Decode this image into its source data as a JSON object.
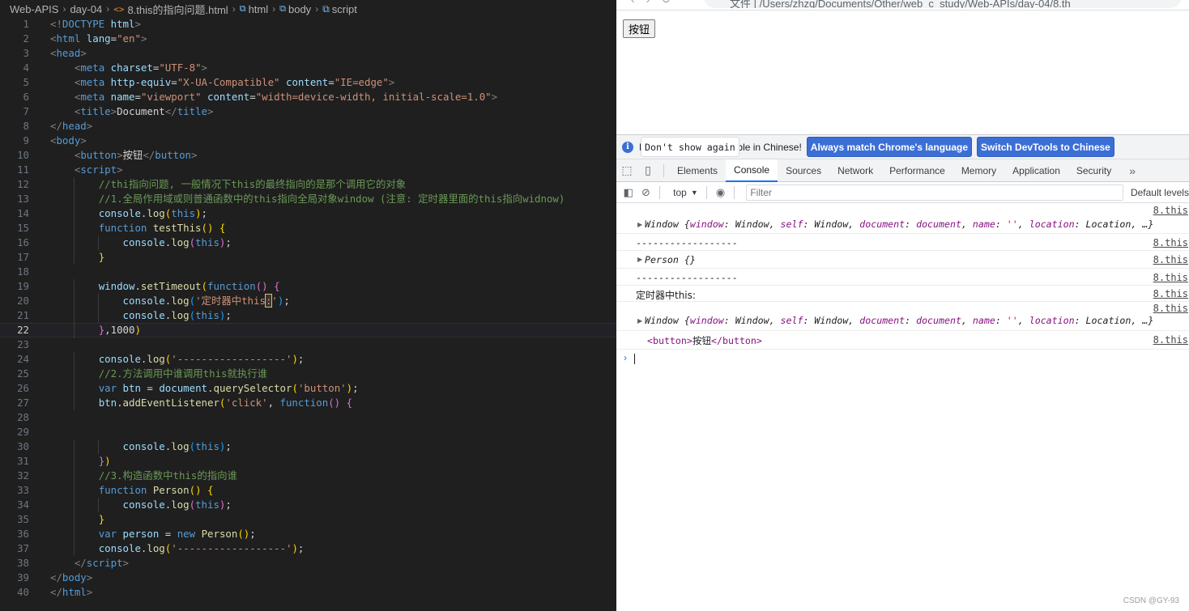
{
  "editor": {
    "breadcrumb": {
      "folder1": "Web-APIS",
      "folder2": "day-04",
      "file": "8.this的指向问题.html",
      "node1": "html",
      "node2": "body",
      "node3": "script"
    },
    "current_line": 22,
    "lines": [
      {
        "n": 1,
        "t": [
          [
            "t-punc",
            "<!"
          ],
          [
            "t-tag",
            "DOCTYPE"
          ],
          [
            "t-txt",
            " "
          ],
          [
            "t-attr",
            "html"
          ],
          [
            "t-punc",
            ">"
          ]
        ]
      },
      {
        "n": 2,
        "t": [
          [
            "t-punc",
            "<"
          ],
          [
            "t-tag",
            "html"
          ],
          [
            "t-txt",
            " "
          ],
          [
            "t-attr",
            "lang"
          ],
          [
            "t-txt",
            "="
          ],
          [
            "t-str",
            "\"en\""
          ],
          [
            "t-punc",
            ">"
          ]
        ]
      },
      {
        "n": 3,
        "t": [
          [
            "t-punc",
            "<"
          ],
          [
            "t-tag",
            "head"
          ],
          [
            "t-punc",
            ">"
          ]
        ]
      },
      {
        "n": 4,
        "t": [
          [
            "t-txt",
            "    "
          ],
          [
            "t-punc",
            "<"
          ],
          [
            "t-tag",
            "meta"
          ],
          [
            "t-txt",
            " "
          ],
          [
            "t-attr",
            "charset"
          ],
          [
            "t-txt",
            "="
          ],
          [
            "t-str",
            "\"UTF-8\""
          ],
          [
            "t-punc",
            ">"
          ]
        ]
      },
      {
        "n": 5,
        "t": [
          [
            "t-txt",
            "    "
          ],
          [
            "t-punc",
            "<"
          ],
          [
            "t-tag",
            "meta"
          ],
          [
            "t-txt",
            " "
          ],
          [
            "t-attr",
            "http-equiv"
          ],
          [
            "t-txt",
            "="
          ],
          [
            "t-str",
            "\"X-UA-Compatible\""
          ],
          [
            "t-txt",
            " "
          ],
          [
            "t-attr",
            "content"
          ],
          [
            "t-txt",
            "="
          ],
          [
            "t-str",
            "\"IE=edge\""
          ],
          [
            "t-punc",
            ">"
          ]
        ]
      },
      {
        "n": 6,
        "t": [
          [
            "t-txt",
            "    "
          ],
          [
            "t-punc",
            "<"
          ],
          [
            "t-tag",
            "meta"
          ],
          [
            "t-txt",
            " "
          ],
          [
            "t-attr",
            "name"
          ],
          [
            "t-txt",
            "="
          ],
          [
            "t-str",
            "\"viewport\""
          ],
          [
            "t-txt",
            " "
          ],
          [
            "t-attr",
            "content"
          ],
          [
            "t-txt",
            "="
          ],
          [
            "t-str",
            "\"width=device-width, initial-scale=1.0\""
          ],
          [
            "t-punc",
            ">"
          ]
        ]
      },
      {
        "n": 7,
        "t": [
          [
            "t-txt",
            "    "
          ],
          [
            "t-punc",
            "<"
          ],
          [
            "t-tag",
            "title"
          ],
          [
            "t-punc",
            ">"
          ],
          [
            "t-txt",
            "Document"
          ],
          [
            "t-punc",
            "</"
          ],
          [
            "t-tag",
            "title"
          ],
          [
            "t-punc",
            ">"
          ]
        ]
      },
      {
        "n": 8,
        "t": [
          [
            "t-punc",
            "</"
          ],
          [
            "t-tag",
            "head"
          ],
          [
            "t-punc",
            ">"
          ]
        ]
      },
      {
        "n": 9,
        "t": [
          [
            "t-punc",
            "<"
          ],
          [
            "t-tag",
            "body"
          ],
          [
            "t-punc",
            ">"
          ]
        ]
      },
      {
        "n": 10,
        "t": [
          [
            "t-txt",
            "    "
          ],
          [
            "t-punc",
            "<"
          ],
          [
            "t-tag",
            "button"
          ],
          [
            "t-punc",
            ">"
          ],
          [
            "t-txt",
            "按钮"
          ],
          [
            "t-punc",
            "</"
          ],
          [
            "t-tag",
            "button"
          ],
          [
            "t-punc",
            ">"
          ]
        ]
      },
      {
        "n": 11,
        "t": [
          [
            "t-txt",
            "    "
          ],
          [
            "t-punc",
            "<"
          ],
          [
            "t-tag",
            "script"
          ],
          [
            "t-punc",
            ">"
          ]
        ]
      },
      {
        "n": 12,
        "t": [
          [
            "t-txt",
            "        "
          ],
          [
            "t-cmt",
            "//thi指向问题, 一般情况下this的最终指向的是那个调用它的对象"
          ]
        ]
      },
      {
        "n": 13,
        "t": [
          [
            "t-txt",
            "        "
          ],
          [
            "t-cmt",
            "//1.全局作用域或则普通函数中的this指向全局对象window (注意: 定时器里面的this指向widnow)"
          ]
        ]
      },
      {
        "n": 14,
        "t": [
          [
            "t-txt",
            "        "
          ],
          [
            "t-var",
            "console"
          ],
          [
            "t-txt",
            "."
          ],
          [
            "t-fn",
            "log"
          ],
          [
            "t-br1",
            "("
          ],
          [
            "t-kw",
            "this"
          ],
          [
            "t-br1",
            ")"
          ],
          [
            "t-txt",
            ";"
          ]
        ]
      },
      {
        "n": 15,
        "t": [
          [
            "t-txt",
            "        "
          ],
          [
            "t-kw",
            "function"
          ],
          [
            "t-txt",
            " "
          ],
          [
            "t-fn",
            "testThis"
          ],
          [
            "t-br1",
            "()"
          ],
          [
            "t-txt",
            " "
          ],
          [
            "t-br1",
            "{"
          ]
        ]
      },
      {
        "n": 16,
        "t": [
          [
            "t-txt",
            "            "
          ],
          [
            "t-var",
            "console"
          ],
          [
            "t-txt",
            "."
          ],
          [
            "t-fn",
            "log"
          ],
          [
            "t-br2",
            "("
          ],
          [
            "t-kw",
            "this"
          ],
          [
            "t-br2",
            ")"
          ],
          [
            "t-txt",
            ";"
          ]
        ]
      },
      {
        "n": 17,
        "t": [
          [
            "t-txt",
            "        "
          ],
          [
            "t-br1",
            "}"
          ]
        ]
      },
      {
        "n": 18,
        "t": []
      },
      {
        "n": 19,
        "t": [
          [
            "t-txt",
            "        "
          ],
          [
            "t-var",
            "window"
          ],
          [
            "t-txt",
            "."
          ],
          [
            "t-fn",
            "setTimeout"
          ],
          [
            "t-br1",
            "("
          ],
          [
            "t-kw",
            "function"
          ],
          [
            "t-br2",
            "()"
          ],
          [
            "t-txt",
            " "
          ],
          [
            "t-br2",
            "{"
          ]
        ]
      },
      {
        "n": 20,
        "t": [
          [
            "t-txt",
            "            "
          ],
          [
            "t-var",
            "console"
          ],
          [
            "t-txt",
            "."
          ],
          [
            "t-fn",
            "log"
          ],
          [
            "t-br3",
            "("
          ],
          [
            "t-str",
            "'定时器中this"
          ],
          [
            "t-hl",
            ":"
          ],
          [
            "t-str",
            "'"
          ],
          [
            "t-br3",
            ")"
          ],
          [
            "t-txt",
            ";"
          ]
        ]
      },
      {
        "n": 21,
        "t": [
          [
            "t-txt",
            "            "
          ],
          [
            "t-var",
            "console"
          ],
          [
            "t-txt",
            "."
          ],
          [
            "t-fn",
            "log"
          ],
          [
            "t-br3",
            "("
          ],
          [
            "t-kw",
            "this"
          ],
          [
            "t-br3",
            ")"
          ],
          [
            "t-txt",
            ";"
          ]
        ]
      },
      {
        "n": 22,
        "t": [
          [
            "t-txt",
            "        "
          ],
          [
            "t-br2",
            "}"
          ],
          [
            "t-txt",
            ",1000"
          ],
          [
            "t-br1",
            ")"
          ]
        ]
      },
      {
        "n": 23,
        "t": []
      },
      {
        "n": 24,
        "t": [
          [
            "t-txt",
            "        "
          ],
          [
            "t-var",
            "console"
          ],
          [
            "t-txt",
            "."
          ],
          [
            "t-fn",
            "log"
          ],
          [
            "t-br1",
            "("
          ],
          [
            "t-str",
            "'------------------'"
          ],
          [
            "t-br1",
            ")"
          ],
          [
            "t-txt",
            ";"
          ]
        ]
      },
      {
        "n": 25,
        "t": [
          [
            "t-txt",
            "        "
          ],
          [
            "t-cmt",
            "//2.方法调用中谁调用this就执行谁"
          ]
        ]
      },
      {
        "n": 26,
        "t": [
          [
            "t-txt",
            "        "
          ],
          [
            "t-kw",
            "var"
          ],
          [
            "t-txt",
            " "
          ],
          [
            "t-var",
            "btn"
          ],
          [
            "t-txt",
            " = "
          ],
          [
            "t-var",
            "document"
          ],
          [
            "t-txt",
            "."
          ],
          [
            "t-fn",
            "querySelector"
          ],
          [
            "t-br1",
            "("
          ],
          [
            "t-str",
            "'button'"
          ],
          [
            "t-br1",
            ")"
          ],
          [
            "t-txt",
            ";"
          ]
        ]
      },
      {
        "n": 27,
        "t": [
          [
            "t-txt",
            "        "
          ],
          [
            "t-var",
            "btn"
          ],
          [
            "t-txt",
            "."
          ],
          [
            "t-fn",
            "addEventListener"
          ],
          [
            "t-br1",
            "("
          ],
          [
            "t-str",
            "'click'"
          ],
          [
            "t-txt",
            ", "
          ],
          [
            "t-kw",
            "function"
          ],
          [
            "t-br2",
            "()"
          ],
          [
            "t-txt",
            " "
          ],
          [
            "t-br2",
            "{"
          ]
        ]
      },
      {
        "n": 28,
        "t": []
      },
      {
        "n": 29,
        "t": []
      },
      {
        "n": 30,
        "t": [
          [
            "t-txt",
            "            "
          ],
          [
            "t-var",
            "console"
          ],
          [
            "t-txt",
            "."
          ],
          [
            "t-fn",
            "log"
          ],
          [
            "t-br3",
            "("
          ],
          [
            "t-kw",
            "this"
          ],
          [
            "t-br3",
            ")"
          ],
          [
            "t-txt",
            ";"
          ]
        ]
      },
      {
        "n": 31,
        "t": [
          [
            "t-txt",
            "        "
          ],
          [
            "t-br2",
            "}"
          ],
          [
            "t-br1",
            ")"
          ]
        ]
      },
      {
        "n": 32,
        "t": [
          [
            "t-txt",
            "        "
          ],
          [
            "t-cmt",
            "//3.构造函数中this的指向谁"
          ]
        ]
      },
      {
        "n": 33,
        "t": [
          [
            "t-txt",
            "        "
          ],
          [
            "t-kw",
            "function"
          ],
          [
            "t-txt",
            " "
          ],
          [
            "t-fn",
            "Person"
          ],
          [
            "t-br1",
            "()"
          ],
          [
            "t-txt",
            " "
          ],
          [
            "t-br1",
            "{"
          ]
        ]
      },
      {
        "n": 34,
        "t": [
          [
            "t-txt",
            "            "
          ],
          [
            "t-var",
            "console"
          ],
          [
            "t-txt",
            "."
          ],
          [
            "t-fn",
            "log"
          ],
          [
            "t-br2",
            "("
          ],
          [
            "t-kw",
            "this"
          ],
          [
            "t-br2",
            ")"
          ],
          [
            "t-txt",
            ";"
          ]
        ]
      },
      {
        "n": 35,
        "t": [
          [
            "t-txt",
            "        "
          ],
          [
            "t-br1",
            "}"
          ]
        ]
      },
      {
        "n": 36,
        "t": [
          [
            "t-txt",
            "        "
          ],
          [
            "t-kw",
            "var"
          ],
          [
            "t-txt",
            " "
          ],
          [
            "t-var",
            "person"
          ],
          [
            "t-txt",
            " = "
          ],
          [
            "t-kw",
            "new"
          ],
          [
            "t-txt",
            " "
          ],
          [
            "t-fn",
            "Person"
          ],
          [
            "t-br1",
            "()"
          ],
          [
            "t-txt",
            ";"
          ]
        ]
      },
      {
        "n": 37,
        "t": [
          [
            "t-txt",
            "        "
          ],
          [
            "t-var",
            "console"
          ],
          [
            "t-txt",
            "."
          ],
          [
            "t-fn",
            "log"
          ],
          [
            "t-br1",
            "("
          ],
          [
            "t-str",
            "'------------------'"
          ],
          [
            "t-br1",
            ")"
          ],
          [
            "t-txt",
            ";"
          ]
        ]
      },
      {
        "n": 38,
        "t": [
          [
            "t-txt",
            "    "
          ],
          [
            "t-punc",
            "</"
          ],
          [
            "t-tag",
            "script"
          ],
          [
            "t-punc",
            ">"
          ]
        ]
      },
      {
        "n": 39,
        "t": [
          [
            "t-punc",
            "</"
          ],
          [
            "t-tag",
            "body"
          ],
          [
            "t-punc",
            ">"
          ]
        ]
      },
      {
        "n": 40,
        "t": [
          [
            "t-punc",
            "</"
          ],
          [
            "t-tag",
            "html"
          ],
          [
            "t-punc",
            ">"
          ]
        ]
      }
    ]
  },
  "browser": {
    "url_fragment": "文件 | /Users/zhzq/Documents/Other/web_c_study/Web-APIs/day-04/8.th",
    "page_button": "按钮"
  },
  "devtools": {
    "info_message": "DevTools is now available in Chinese!",
    "info_btn_match": "Always match Chrome's language",
    "info_btn_switch": "Switch DevTools to Chinese",
    "info_btn_dismiss": "Don't show again",
    "tabs": [
      "Elements",
      "Console",
      "Sources",
      "Network",
      "Performance",
      "Memory",
      "Application",
      "Security"
    ],
    "active_tab": "Console",
    "context": "top",
    "filter_placeholder": "Filter",
    "levels": "Default levels",
    "source": "8.this",
    "window_obj_parts": {
      "head": "Window {",
      "k1": "window",
      "v1": ": Window, ",
      "k2": "self",
      "v2": ": Window, ",
      "k3": "document",
      "v3a": ": ",
      "v3": "document",
      "v3b": ", ",
      "k4": "name",
      "v4a": ": ",
      "v4": "''",
      "v4b": ", ",
      "k5": "location",
      "v5": ": Location, …}"
    },
    "dashes": "------------------",
    "person_obj": "Person {}",
    "timer_text": "定时器中this:",
    "button_el": {
      "open": "<button>",
      "text": "按钮",
      "close": "</button>"
    }
  },
  "watermark": "CSDN @GY-93"
}
